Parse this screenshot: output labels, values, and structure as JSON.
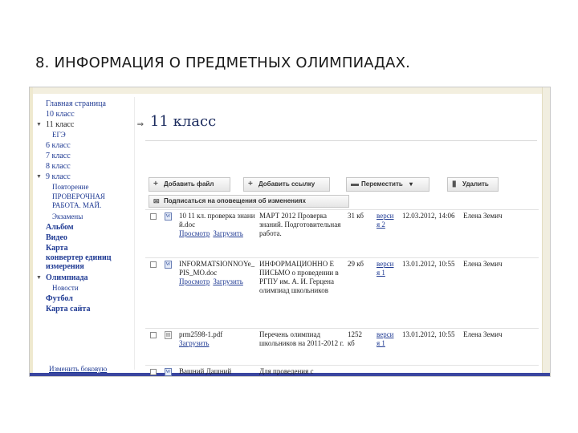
{
  "slide": {
    "title": "8. ИНФОРМАЦИЯ О ПРЕДМЕТНЫХ ОЛИМПИАДАХ."
  },
  "sidebar": {
    "items": [
      {
        "label": "Главная страница",
        "level": 0,
        "arrow": ""
      },
      {
        "label": "10 класс",
        "level": 0,
        "arrow": ""
      },
      {
        "label": "11 класс",
        "level": 0,
        "arrow": "▼",
        "current": true,
        "side_icon": "⇒"
      },
      {
        "label": "ЕГЭ",
        "level": 1,
        "arrow": ""
      },
      {
        "label": "6 класс",
        "level": 0,
        "arrow": ""
      },
      {
        "label": "7 класс",
        "level": 0,
        "arrow": ""
      },
      {
        "label": "8 класс",
        "level": 0,
        "arrow": ""
      },
      {
        "label": "9 класс",
        "level": 0,
        "arrow": "▼"
      },
      {
        "label": "Повторение",
        "level": 1,
        "arrow": ""
      },
      {
        "label": "ПРОВЕРОЧНАЯ РАБОТА. МАЙ.",
        "level": 1,
        "arrow": "",
        "wrap": true
      },
      {
        "label": "Экзамены",
        "level": 1,
        "arrow": ""
      },
      {
        "label": "Альбом",
        "level": 0,
        "arrow": "",
        "bold": true
      },
      {
        "label": "Видео",
        "level": 0,
        "arrow": "",
        "bold": true
      },
      {
        "label": "Карта",
        "level": 0,
        "arrow": "",
        "bold": true
      },
      {
        "label": "конвертер единиц измерения",
        "level": 0,
        "arrow": "",
        "bold": true,
        "wrap": true
      },
      {
        "label": "Олимпиада",
        "level": 0,
        "arrow": "▼",
        "bold": true
      },
      {
        "label": "Новости",
        "level": 1,
        "arrow": ""
      },
      {
        "label": "Футбол",
        "level": 0,
        "arrow": "",
        "bold": true
      },
      {
        "label": "Карта сайта",
        "level": 0,
        "arrow": "",
        "bold": true
      }
    ],
    "bottom_link": "Изменить боковую"
  },
  "main": {
    "heading": "11 класс",
    "toolbar": {
      "add_file": "Добавить файл",
      "add_link": "Добавить ссылку",
      "move": "Переместить",
      "delete": "Удалить",
      "subscribe": "Подписаться на оповещения об изменениях"
    },
    "files": [
      {
        "name": "10 11 кл. проверка знаний.doc",
        "actions": [
          "Просмотр",
          "Загрузить"
        ],
        "description": "МАРТ 2012 Проверка знаний. Подготовительная работа.",
        "size": "31 кб",
        "version": "верси я 2",
        "date": "12.03.2012, 14:06",
        "author": "Елена Земич"
      },
      {
        "name": "INFORMATSIONNOYe_PIS_MO.doc",
        "actions": [
          "Просмотр",
          "Загрузить"
        ],
        "description": "ИНФОРМАЦИОННО Е ПИСЬМО о проведении в РГПУ им. А. И. Герцена олимпиад школьников",
        "size": "29 кб",
        "version": "верси я 1",
        "date": "13.01.2012, 10:55",
        "author": "Елена Земич"
      },
      {
        "name": "prm2598-1.pdf",
        "actions": [
          "Загрузить"
        ],
        "description": "Перечень олимпиад школьников на 2011-2012 г.",
        "size": "1252 кб",
        "version": "верси я 1",
        "date": "13.01.2012, 10:55",
        "author": "Елена Земич"
      },
      {
        "name": "Вашний Дашний",
        "actions": [],
        "description": "Для проведения с",
        "size": "",
        "version": "",
        "date": "",
        "author": ""
      }
    ]
  }
}
